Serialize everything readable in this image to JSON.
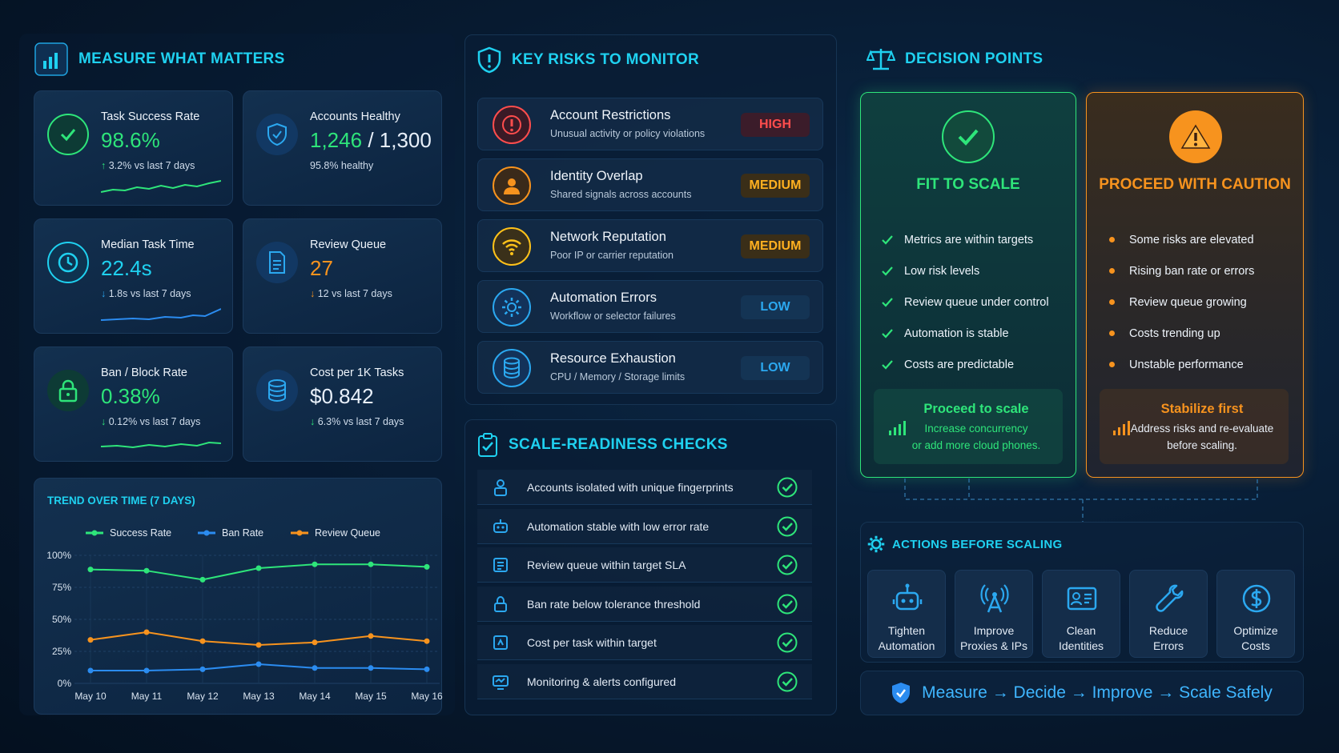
{
  "measure": {
    "title": "MEASURE WHAT MATTERS",
    "cards": [
      {
        "label": "Task Success Rate",
        "value": "98.6%",
        "arrow": "↑",
        "delta": "3.2% vs last 7 days",
        "icon": "check-circle-icon"
      },
      {
        "label": "Accounts Healthy",
        "value": "1,246",
        "value_suffix": "/ 1,300",
        "delta": "95.8% healthy",
        "icon": "shield-icon"
      },
      {
        "label": "Median Task Time",
        "value": "22.4s",
        "arrow": "↓",
        "delta": "1.8s vs last 7 days",
        "icon": "clock-icon"
      },
      {
        "label": "Review Queue",
        "value": "27",
        "arrow": "↓",
        "delta": "12 vs last 7 days",
        "icon": "document-icon"
      },
      {
        "label": "Ban / Block Rate",
        "value": "0.38%",
        "arrow": "↓",
        "delta": "0.12% vs last 7 days",
        "icon": "lock-icon"
      },
      {
        "label": "Cost per 1K Tasks",
        "value": "$0.842",
        "arrow": "↓",
        "delta": "6.3% vs last 7 days",
        "icon": "database-icon"
      }
    ]
  },
  "chart_data": {
    "type": "line",
    "title": "TREND OVER TIME (7 DAYS)",
    "x": [
      "May 10",
      "May 11",
      "May 12",
      "May 13",
      "May 14",
      "May 15",
      "May 16"
    ],
    "y_ticks": [
      "100%",
      "75%",
      "50%",
      "25%",
      "0%"
    ],
    "ylim": [
      0,
      100
    ],
    "grid": true,
    "legend": "top",
    "series": [
      {
        "name": "Success Rate",
        "color": "#2ee57a",
        "values": [
          89,
          88,
          81,
          90,
          93,
          93,
          91
        ]
      },
      {
        "name": "Ban Rate",
        "color": "#2b8cf0",
        "values": [
          10,
          10,
          11,
          15,
          12,
          12,
          11
        ]
      },
      {
        "name": "Review Queue",
        "color": "#f7931e",
        "values": [
          34,
          40,
          33,
          30,
          32,
          37,
          33
        ]
      }
    ]
  },
  "risks": {
    "title": "KEY RISKS TO MONITOR",
    "items": [
      {
        "title": "Account Restrictions",
        "sub": "Unusual activity or policy violations",
        "level": "HIGH",
        "icon": "alert-circle-icon"
      },
      {
        "title": "Identity Overlap",
        "sub": "Shared signals across accounts",
        "level": "MEDIUM",
        "icon": "user-icon"
      },
      {
        "title": "Network Reputation",
        "sub": "Poor IP or carrier reputation",
        "level": "MEDIUM",
        "icon": "wifi-icon"
      },
      {
        "title": "Automation Errors",
        "sub": "Workflow or selector failures",
        "level": "LOW",
        "icon": "gear-icon"
      },
      {
        "title": "Resource Exhaustion",
        "sub": "CPU / Memory / Storage limits",
        "level": "LOW",
        "icon": "database-icon"
      }
    ]
  },
  "checks": {
    "title": "SCALE-READINESS CHECKS",
    "items": [
      {
        "text": "Accounts isolated with unique fingerprints",
        "icon": "user-lock-icon"
      },
      {
        "text": "Automation stable with low error rate",
        "icon": "robot-icon"
      },
      {
        "text": "Review queue within target SLA",
        "icon": "queue-icon"
      },
      {
        "text": "Ban rate below tolerance threshold",
        "icon": "lock-icon"
      },
      {
        "text": "Cost per task within target",
        "icon": "cost-icon"
      },
      {
        "text": "Monitoring & alerts configured",
        "icon": "monitor-icon"
      }
    ]
  },
  "decision": {
    "title": "DECISION POINTS",
    "fit": {
      "heading": "FIT TO SCALE",
      "items": [
        "Metrics are within targets",
        "Low risk levels",
        "Review queue under control",
        "Automation is stable",
        "Costs are predictable"
      ],
      "box_title": "Proceed to scale",
      "box_line1": "Increase concurrency",
      "box_line2": "or add more cloud phones."
    },
    "caution": {
      "heading": "PROCEED WITH CAUTION",
      "items": [
        "Some risks are elevated",
        "Rising ban rate or errors",
        "Review queue growing",
        "Costs trending up",
        "Unstable performance"
      ],
      "box_title": "Stabilize first",
      "box_line1": "Address risks and re-evaluate",
      "box_line2": "before scaling."
    }
  },
  "actions": {
    "title": "ACTIONS BEFORE SCALING",
    "items": [
      {
        "line1": "Tighten",
        "line2": "Automation",
        "icon": "robot-icon"
      },
      {
        "line1": "Improve",
        "line2": "Proxies & IPs",
        "icon": "antenna-icon"
      },
      {
        "line1": "Clean",
        "line2": "Identities",
        "icon": "id-card-icon"
      },
      {
        "line1": "Reduce",
        "line2": "Errors",
        "icon": "wrench-icon"
      },
      {
        "line1": "Optimize",
        "line2": "Costs",
        "icon": "dollar-icon"
      }
    ]
  },
  "footer": {
    "text": "Measure → Decide → Improve → Scale Safely"
  },
  "colors": {
    "accent": "#1fd1f0",
    "green": "#2ee57a",
    "orange": "#f7931e",
    "high": "#ff4d4d",
    "medium": "#ffb020",
    "low": "#2ba8f0"
  }
}
